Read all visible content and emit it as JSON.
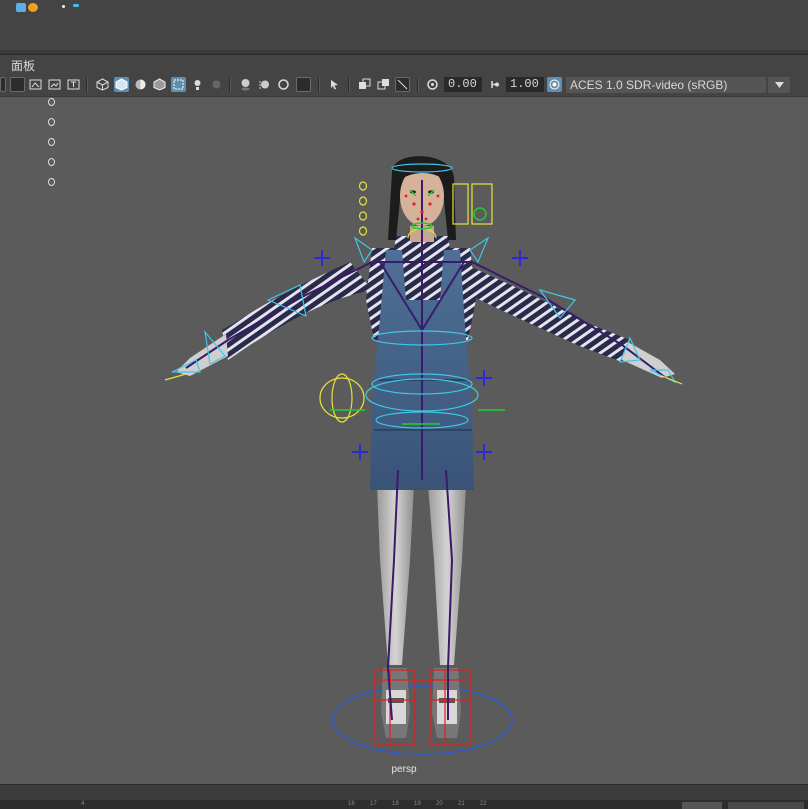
{
  "panel_menu": {
    "label": "面板"
  },
  "toolbar": {
    "exposure_value": "0.00",
    "gamma_value": "1.00",
    "color_space": "ACES 1.0 SDR-video (sRGB)"
  },
  "viewport": {
    "camera_name": "persp"
  },
  "timeline": {
    "visible_ticks": [
      "4",
      "16",
      "17",
      "18",
      "19",
      "20",
      "21",
      "22"
    ]
  },
  "colors": {
    "viewport_bg": "#5b5b5b",
    "ui_bg": "#444444",
    "active_button": "#5f8fb0",
    "rig_cyan": "#3fc7e6",
    "rig_yellow": "#e6e23a",
    "rig_green": "#22cc33",
    "rig_blue": "#2a2ad8",
    "rig_red": "#e02020"
  }
}
